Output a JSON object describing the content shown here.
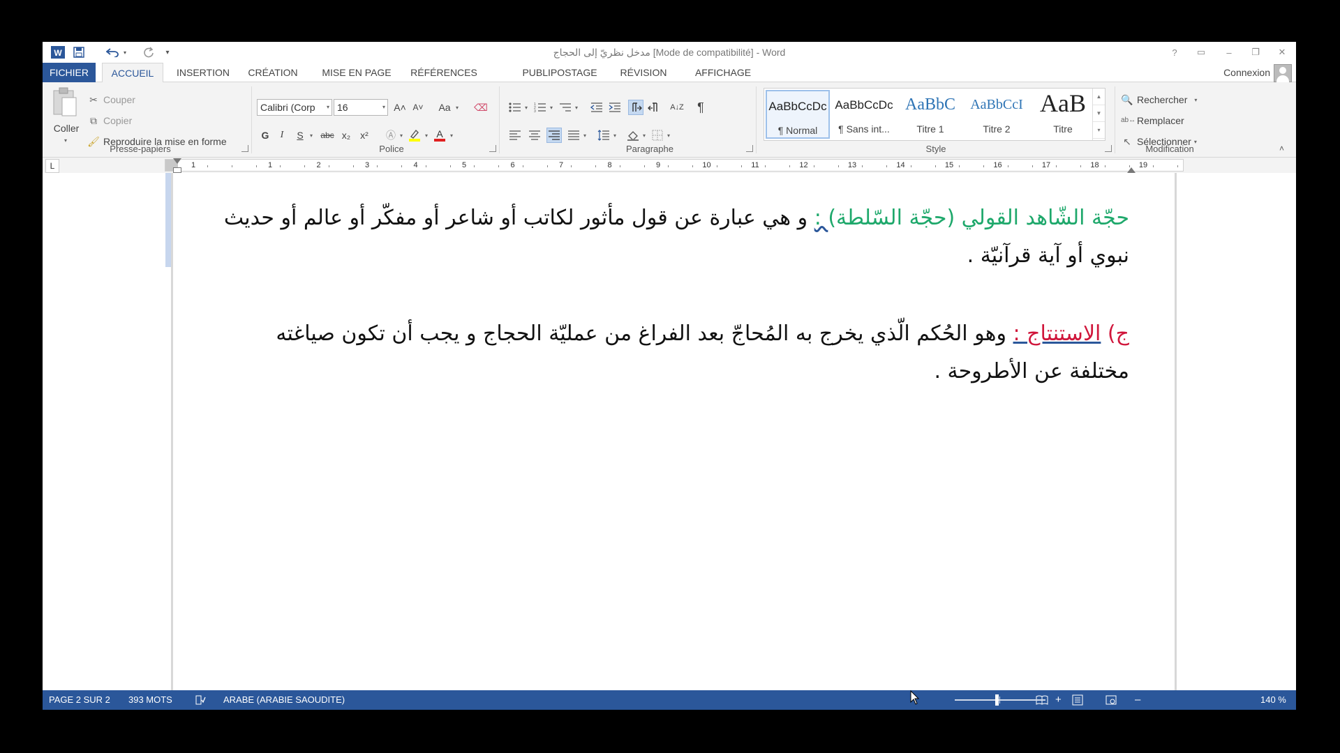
{
  "titlebar": {
    "title": "مدخل نظريّ إلى الحجاج [Mode de compatibilité] - Word",
    "qat": {
      "word_icon": "W",
      "more": "▾"
    },
    "controls": [
      "?",
      "▭",
      "–",
      "❐",
      "✕"
    ]
  },
  "tabs": {
    "items": [
      "FICHIER",
      "ACCUEIL",
      "INSERTION",
      "CRÉATION",
      "MISE EN PAGE",
      "RÉFÉRENCES",
      "PUBLIPOSTAGE",
      "RÉVISION",
      "AFFICHAGE"
    ],
    "active": "ACCUEIL",
    "account": "Connexion"
  },
  "ribbon": {
    "clipboard": {
      "label": "Presse-papiers",
      "paste": "Coller",
      "cut": "Couper",
      "copy": "Copier",
      "format_painter": "Reproduire la mise en forme"
    },
    "font": {
      "label": "Police",
      "font_name": "Calibri (Corp",
      "font_size": "16",
      "bold": "G",
      "italic": "I",
      "underline": "S",
      "strike": "abc",
      "subscript": "x₂",
      "superscript": "x²",
      "grow": "A˄",
      "shrink": "A˅",
      "case": "Aa",
      "highlight_color": "#ffff00",
      "font_color": "#e02020"
    },
    "paragraph": {
      "label": "Paragraphe",
      "sort": "A↓Z",
      "pilcrow": "¶"
    },
    "styles": {
      "label": "Style",
      "items": [
        {
          "preview": "AaBbCcDc",
          "name": "¶ Normal"
        },
        {
          "preview": "AaBbCcDc",
          "name": "¶ Sans int..."
        },
        {
          "preview": "AaBbC",
          "name": "Titre 1"
        },
        {
          "preview": "AaBbCcI",
          "name": "Titre 2"
        },
        {
          "preview": "AaB",
          "name": "Titre"
        }
      ]
    },
    "editing": {
      "label": "Modification",
      "find": "Rechercher",
      "replace": "Remplacer",
      "select": "Sélectionner"
    }
  },
  "ruler": {
    "tab_selector": "L",
    "numbers": [
      "1",
      "1",
      "2",
      "3",
      "4",
      "5",
      "6",
      "7",
      "8",
      "9",
      "10",
      "11",
      "12",
      "13",
      "14",
      "15",
      "16",
      "17",
      "18",
      "19"
    ]
  },
  "document": {
    "p1": {
      "heading": "حجّة الشّاهد القولي (حجّة السّلطة)",
      "colon": " :",
      "body": " و هي عبارة عن قول مأثور لكاتب أو شاعر أو مفكّر أو عالم أو حديث نبوي أو آية قرآنيّة ."
    },
    "p2": {
      "prefix": "ج) ",
      "term": "الاستنتاج :",
      "body": "  وهو الحُكم الّذي يخرج به المُحاجّ بعد الفراغ من عمليّة الحجاج و يجب أن تكون صياغته مختلفة عن الأطروحة ."
    },
    "colors": {
      "heading": "#1ea86b",
      "term": "#d0163b"
    }
  },
  "statusbar": {
    "page": "PAGE 2 SUR 2",
    "words": "393 MOTS",
    "language": "ARABE (ARABIE SAOUDITE)",
    "zoom_minus": "–",
    "zoom_plus": "+",
    "zoom": "140 %",
    "zoom_percent": 140
  }
}
